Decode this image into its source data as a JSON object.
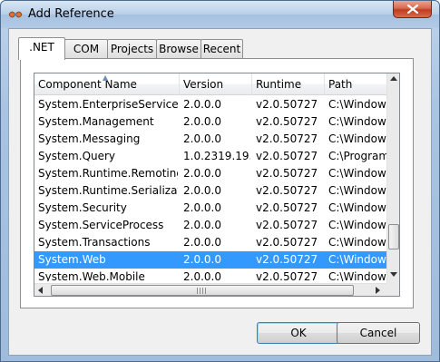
{
  "window": {
    "title": "Add Reference"
  },
  "tabs": [
    {
      "label": ".NET",
      "active": true
    },
    {
      "label": "COM",
      "active": false
    },
    {
      "label": "Projects",
      "active": false
    },
    {
      "label": "Browse",
      "active": false
    },
    {
      "label": "Recent",
      "active": false
    }
  ],
  "list": {
    "columns": [
      "Component Name",
      "Version",
      "Runtime",
      "Path"
    ],
    "sorted_column": "Component Name",
    "rows": [
      {
        "name": "System.EnterpriseServices",
        "version": "2.0.0.0",
        "runtime": "v2.0.50727",
        "path": "C:\\Windows",
        "selected": false
      },
      {
        "name": "System.Management",
        "version": "2.0.0.0",
        "runtime": "v2.0.50727",
        "path": "C:\\Windows",
        "selected": false
      },
      {
        "name": "System.Messaging",
        "version": "2.0.0.0",
        "runtime": "v2.0.50727",
        "path": "C:\\Windows",
        "selected": false
      },
      {
        "name": "System.Query",
        "version": "1.0.2319.19...",
        "runtime": "v2.0.50727",
        "path": "C:\\Program",
        "selected": false
      },
      {
        "name": "System.Runtime.Remoting",
        "version": "2.0.0.0",
        "runtime": "v2.0.50727",
        "path": "C:\\Windows",
        "selected": false
      },
      {
        "name": "System.Runtime.Serializati...",
        "version": "2.0.0.0",
        "runtime": "v2.0.50727",
        "path": "C:\\Windows",
        "selected": false
      },
      {
        "name": "System.Security",
        "version": "2.0.0.0",
        "runtime": "v2.0.50727",
        "path": "C:\\Windows",
        "selected": false
      },
      {
        "name": "System.ServiceProcess",
        "version": "2.0.0.0",
        "runtime": "v2.0.50727",
        "path": "C:\\Windows",
        "selected": false
      },
      {
        "name": "System.Transactions",
        "version": "2.0.0.0",
        "runtime": "v2.0.50727",
        "path": "C:\\Windows",
        "selected": false
      },
      {
        "name": "System.Web",
        "version": "2.0.0.0",
        "runtime": "v2.0.50727",
        "path": "C:\\Windows",
        "selected": true
      },
      {
        "name": "System.Web.Mobile",
        "version": "2.0.0.0",
        "runtime": "v2.0.50727",
        "path": "C:\\Windows",
        "selected": false
      }
    ]
  },
  "buttons": {
    "ok": "OK",
    "cancel": "Cancel"
  },
  "colors": {
    "selection": "#3399ff",
    "close_button": "#c23a1f",
    "titlebar": "#b9cfe8"
  }
}
